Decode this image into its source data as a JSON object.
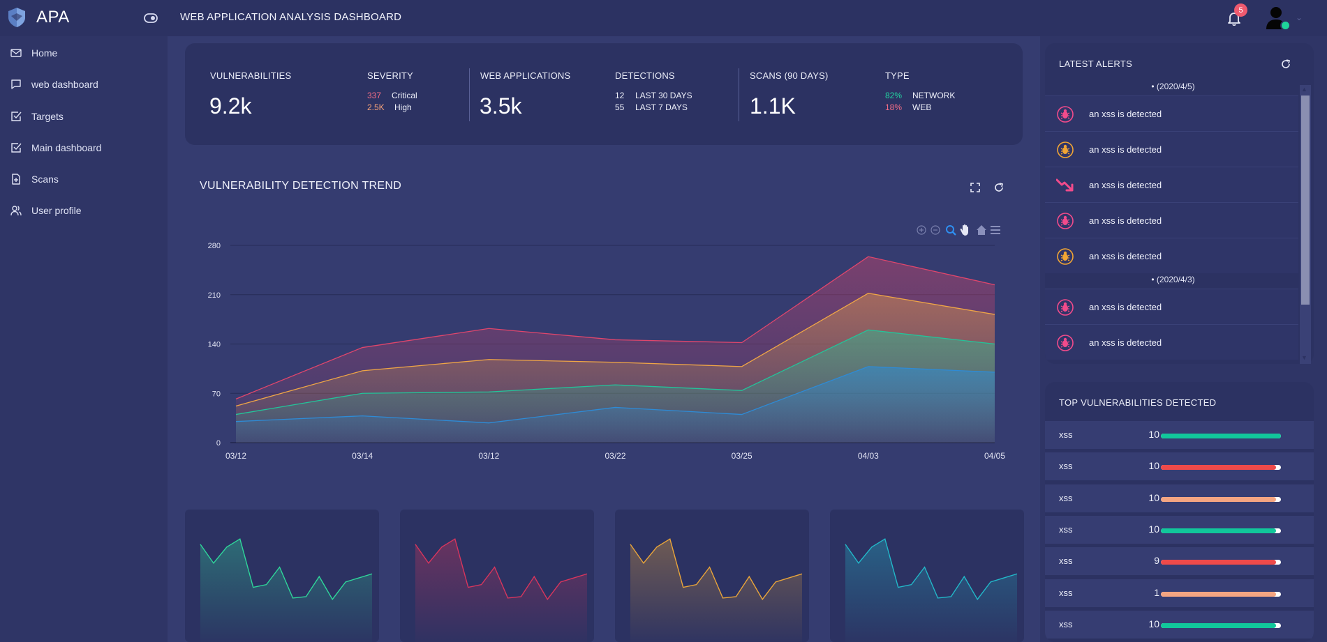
{
  "app": {
    "name": "APA",
    "title": "WEB APPLICATION ANALYSIS DASHBOARD"
  },
  "notifications": {
    "count": "5"
  },
  "sidebar": {
    "items": [
      {
        "label": "Home",
        "icon": "mail-icon"
      },
      {
        "label": "web dashboard",
        "icon": "chat-icon"
      },
      {
        "label": "Targets",
        "icon": "checkbox-icon"
      },
      {
        "label": "Main dashboard",
        "icon": "checkbox-icon"
      },
      {
        "label": "Scans",
        "icon": "file-plus-icon"
      },
      {
        "label": "User profile",
        "icon": "users-icon"
      }
    ]
  },
  "stats": {
    "vulnerabilities": {
      "label": "VULNERABILITIES",
      "value": "9.2k"
    },
    "severity": {
      "label": "SEVERITY",
      "rows": [
        {
          "num": "337",
          "text": "Critical"
        },
        {
          "num": "2.5K",
          "text": "High"
        }
      ]
    },
    "web_apps": {
      "label": "WEB APPLICATIONS",
      "value": "3.5k"
    },
    "detections": {
      "label": "DETECTIONS",
      "rows": [
        {
          "num": "12",
          "text": "LAST 30 DAYS"
        },
        {
          "num": "55",
          "text": "LAST 7 DAYS"
        }
      ]
    },
    "scans": {
      "label": "SCANS (90 DAYS)",
      "value": "1.1K"
    },
    "type": {
      "label": "TYPE",
      "rows": [
        {
          "num": "82%",
          "text": "NETWORK"
        },
        {
          "num": "18%",
          "text": "WEB"
        }
      ]
    }
  },
  "colors": {
    "critical": "#f26d86",
    "high": "#f5a27a",
    "network": "#23d3a0",
    "web": "#f26d86",
    "series": [
      "#2e8bd6",
      "#23c49a",
      "#f0a646",
      "#e0466c"
    ],
    "bar_green": "#11c79b",
    "bar_red": "#ee4a4a",
    "bar_peach": "#f4a582"
  },
  "trend": {
    "title": "VULNERABILITY DETECTION TREND"
  },
  "chart_data": {
    "type": "area",
    "title": "VULNERABILITY DETECTION TREND",
    "categories": [
      "03/12",
      "03/14",
      "03/12",
      "03/22",
      "03/25",
      "04/03",
      "04/05"
    ],
    "x": [
      0,
      2,
      4,
      6,
      8,
      10,
      12
    ],
    "yticks": [
      0,
      70,
      140,
      210,
      280
    ],
    "ylim": [
      0,
      280
    ],
    "stacked_display": true,
    "series": [
      {
        "values": [
          30,
          38,
          28,
          50,
          40,
          108,
          100
        ]
      },
      {
        "values": [
          40,
          70,
          72,
          82,
          74,
          160,
          140
        ]
      },
      {
        "values": [
          52,
          102,
          118,
          114,
          108,
          212,
          182
        ]
      },
      {
        "values": [
          62,
          135,
          162,
          146,
          142,
          264,
          224
        ]
      }
    ],
    "mini_series": [
      [
        52,
        38,
        50,
        56,
        20,
        22,
        35,
        12,
        13,
        28,
        11,
        24,
        27,
        30
      ]
    ]
  },
  "alerts": {
    "title": "LATEST ALERTS",
    "groups": [
      {
        "date": "• (2020/4/5)",
        "items": [
          {
            "text": "an xss is detected",
            "icon": "bug-icon",
            "color": "#f24b8b"
          },
          {
            "text": "an xss is detected",
            "icon": "bug-icon",
            "color": "#f1a534"
          },
          {
            "text": "an xss is detected",
            "icon": "trend-down-icon",
            "color": "#f24b8b"
          },
          {
            "text": "an xss is detected",
            "icon": "bug-icon",
            "color": "#f24b8b"
          },
          {
            "text": "an xss is detected",
            "icon": "bug-icon",
            "color": "#f1a534"
          }
        ]
      },
      {
        "date": "• (2020/4/3)",
        "items": [
          {
            "text": "an xss is detected",
            "icon": "bug-icon",
            "color": "#f24b8b"
          },
          {
            "text": "an xss is detected",
            "icon": "bug-icon",
            "color": "#f24b8b"
          }
        ]
      }
    ]
  },
  "top_vulns": {
    "title": "TOP VULNERABILITIES DETECTED",
    "rows": [
      {
        "name": "xss",
        "count": "10",
        "level": 1.0,
        "color": "#11c79b"
      },
      {
        "name": "xss",
        "count": "10",
        "level": 0.96,
        "color": "#ee4a4a"
      },
      {
        "name": "xss",
        "count": "10",
        "level": 0.96,
        "color": "#f4a582"
      },
      {
        "name": "xss",
        "count": "10",
        "level": 0.96,
        "color": "#11c79b"
      },
      {
        "name": "xss",
        "count": "9",
        "level": 0.96,
        "color": "#ee4a4a"
      },
      {
        "name": "xss",
        "count": "1",
        "level": 0.96,
        "color": "#f4a582"
      },
      {
        "name": "xss",
        "count": "10",
        "level": 0.96,
        "color": "#11c79b"
      }
    ]
  }
}
